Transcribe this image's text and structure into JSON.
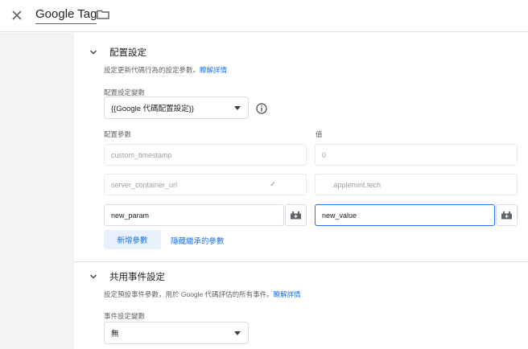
{
  "header": {
    "close_icon": "close-icon",
    "title": "Google Tag",
    "folder_icon": "folder-icon"
  },
  "config_section": {
    "title": "配置設定",
    "description": "設定更新代碼行為的設定參數。",
    "learn_more": "瞭解詳情",
    "variable_label": "配置設定變數",
    "variable_value": "{{Google 代碼配置設定}}",
    "param_header": "配置參數",
    "value_header": "值",
    "inherited_rows": [
      {
        "name": "custom_timestamp",
        "value": "0"
      },
      {
        "name": "server_container_url",
        "value": ".applemint.tech"
      }
    ],
    "editable_row": {
      "name": "new_param",
      "value": "new_value"
    },
    "add_button": "新增參數",
    "hide_inherited": "隱藏繼承的參數"
  },
  "event_section": {
    "title": "共用事件設定",
    "description": "設定預設事件參數，用於 Google 代碼評估的所有事件。",
    "learn_more": "瞭解詳情",
    "variable_label": "事件設定變數",
    "variable_value": "無"
  },
  "colors": {
    "accent": "#1a73e8",
    "sidebar_bg": "#f1f3f4",
    "border": "#dadce0"
  }
}
